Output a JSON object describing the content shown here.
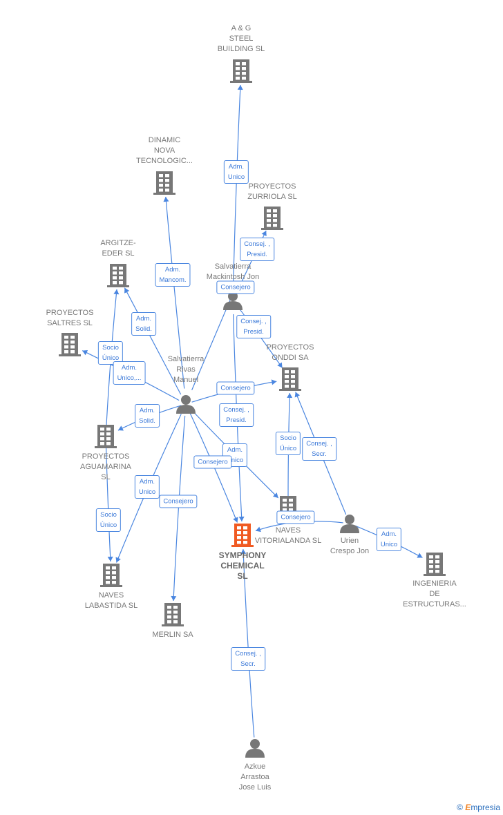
{
  "colors": {
    "edge": "#4a86e0",
    "node": "#777777",
    "main": "#f05a22"
  },
  "nodes": [
    {
      "id": "ag",
      "type": "company",
      "label": "A & G\nSTEEL\nBUILDING  SL"
    },
    {
      "id": "dinamic",
      "type": "company",
      "label": "DINAMIC\nNOVA\nTECNOLOGIC..."
    },
    {
      "id": "zurriola",
      "type": "company",
      "label": "PROYECTOS\nZURRIOLA  SL"
    },
    {
      "id": "argitze",
      "type": "company",
      "label": "ARGITZE-\nEDER SL"
    },
    {
      "id": "saltres",
      "type": "company",
      "label": "PROYECTOS\nSALTRES  SL"
    },
    {
      "id": "mackintosh",
      "type": "person",
      "label": "Salvatierra\nMackintosh Jon"
    },
    {
      "id": "onddi",
      "type": "company",
      "label": "PROYECTOS\nONDDI SA"
    },
    {
      "id": "manuel",
      "type": "person",
      "label": "Salvatierra\nRivas\nManuel"
    },
    {
      "id": "aguamarina",
      "type": "company",
      "label": "PROYECTOS\nAGUAMARINA\nSL"
    },
    {
      "id": "symphony",
      "type": "main",
      "label": "SYMPHONY\nCHEMICAL\nSL"
    },
    {
      "id": "naves",
      "type": "company",
      "label": "NAVES\nVITORIALANDA SL"
    },
    {
      "id": "urien",
      "type": "person",
      "label": "Urien\nCrespo Jon"
    },
    {
      "id": "ingenieria",
      "type": "company",
      "label": "INGENIERIA\nDE\nESTRUCTURAS..."
    },
    {
      "id": "labastida",
      "type": "company",
      "label": "NAVES\nLABASTIDA SL"
    },
    {
      "id": "merlin",
      "type": "company",
      "label": "MERLIN SA"
    },
    {
      "id": "azkue",
      "type": "person",
      "label": "Azkue\nArrastoa\nJose Luis"
    }
  ],
  "edges": [
    {
      "from": "mackintosh",
      "to": "ag",
      "label": "Adm.\nUnico"
    },
    {
      "from": "mackintosh",
      "to": "zurriola",
      "label": "Consej. ,\nPresid."
    },
    {
      "from": "manuel",
      "to": "dinamic",
      "label": "Adm.\nMancom."
    },
    {
      "from": "manuel",
      "to": "mackintosh",
      "label": "Consejero"
    },
    {
      "from": "mackintosh",
      "to": "onddi",
      "label": "Consej. ,\nPresid."
    },
    {
      "from": "manuel",
      "to": "argitze",
      "label": "Adm.\nSolid."
    },
    {
      "from": "aguamarina",
      "to": "argitze",
      "label": "Socio\nÚnico"
    },
    {
      "from": "manuel",
      "to": "saltres",
      "label": "Adm.\nUnico,..."
    },
    {
      "from": "manuel",
      "to": "onddi",
      "label": "Consejero"
    },
    {
      "from": "mackintosh",
      "to": "symphony",
      "label": "Consej. ,\nPresid."
    },
    {
      "from": "manuel",
      "to": "aguamarina",
      "label": "Adm.\nSolid."
    },
    {
      "from": "manuel",
      "to": "naves",
      "label": "Adm.\nUnico"
    },
    {
      "from": "manuel",
      "to": "symphony",
      "label": "Consejero"
    },
    {
      "from": "naves",
      "to": "onddi",
      "label": "Socio\nÚnico"
    },
    {
      "from": "urien",
      "to": "onddi",
      "label": "Consej. ,\nSecr."
    },
    {
      "from": "manuel",
      "to": "labastida",
      "label": "Adm.\nUnico"
    },
    {
      "from": "manuel",
      "to": "merlin",
      "label": "Consejero"
    },
    {
      "from": "aguamarina",
      "to": "labastida",
      "label": "Socio\nÚnico"
    },
    {
      "from": "urien",
      "to": "symphony",
      "label": "Consejero"
    },
    {
      "from": "urien",
      "to": "ingenieria",
      "label": "Adm.\nUnico"
    },
    {
      "from": "azkue",
      "to": "symphony",
      "label": "Consej. ,\nSecr."
    }
  ],
  "footer": {
    "copyright": "©",
    "brand_initial": "E",
    "brand_rest": "mpresia"
  }
}
